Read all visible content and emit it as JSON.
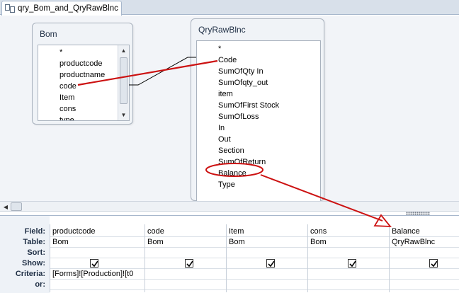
{
  "tab": {
    "title": "qry_Bom_and_QryRawBlnc"
  },
  "tables": {
    "bom": {
      "title": "Bom",
      "fields": [
        "*",
        "productcode",
        "productname",
        "code",
        "Item",
        "cons",
        "type"
      ]
    },
    "qryrawblnc": {
      "title": "QryRawBlnc",
      "fields": [
        "*",
        "Code",
        "SumOfQty In",
        "SumOfqty_out",
        "item",
        "SumOfFirst Stock",
        "SumOfLoss",
        "In",
        "Out",
        "Section",
        "SumOfReturn",
        "Balance",
        "Type"
      ]
    }
  },
  "grid": {
    "row_labels": {
      "field": "Field:",
      "table": "Table:",
      "sort": "Sort:",
      "show": "Show:",
      "criteria": "Criteria:",
      "or": "or:"
    },
    "columns": [
      {
        "field": "productcode",
        "table": "Bom",
        "sort": "",
        "show": true,
        "criteria": "[Forms]![Production]![t0",
        "or": ""
      },
      {
        "field": "code",
        "table": "Bom",
        "sort": "",
        "show": true,
        "criteria": "",
        "or": ""
      },
      {
        "field": "Item",
        "table": "Bom",
        "sort": "",
        "show": true,
        "criteria": "",
        "or": ""
      },
      {
        "field": "cons",
        "table": "Bom",
        "sort": "",
        "show": true,
        "criteria": "",
        "or": ""
      },
      {
        "field": "Balance",
        "table": "QryRawBlnc",
        "sort": "",
        "show": true,
        "criteria": "",
        "or": ""
      }
    ]
  },
  "colors": {
    "annotation": "#cc1111",
    "header_bg": "#d8e0ea",
    "design_bg": "#f2f4f8"
  }
}
